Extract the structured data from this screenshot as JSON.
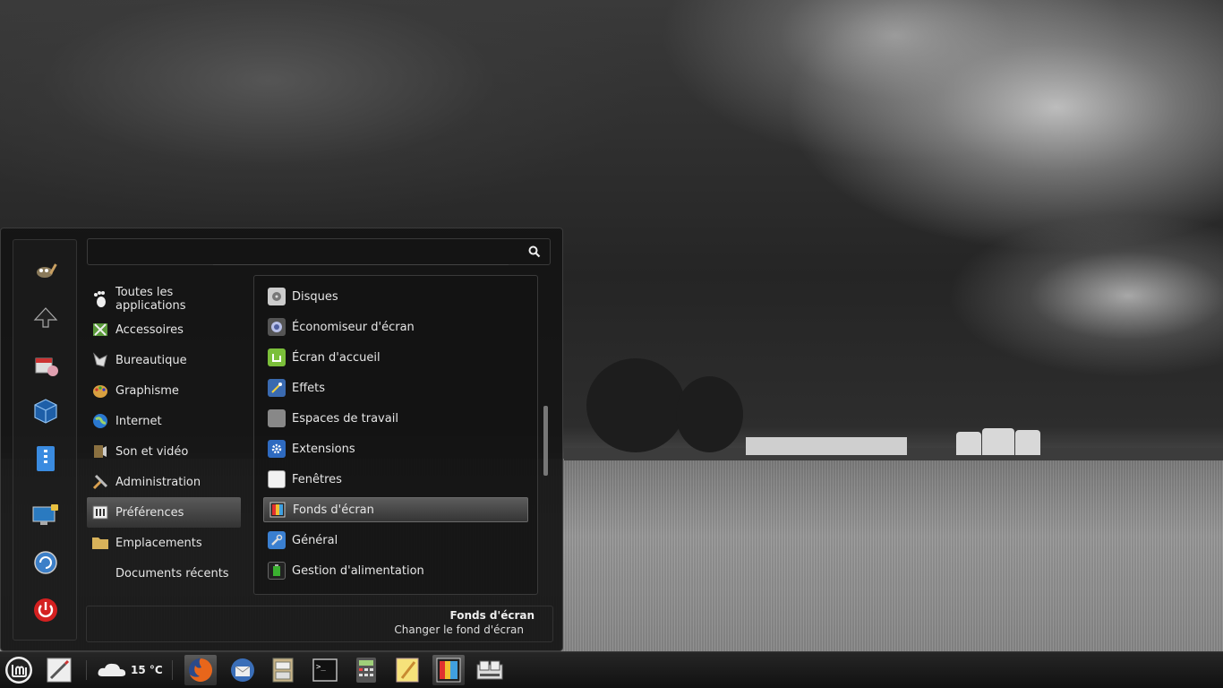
{
  "search": {
    "value": "",
    "placeholder": ""
  },
  "categories": [
    {
      "label": "Toutes les applications",
      "icon": "foot-icon"
    },
    {
      "label": "Accessoires",
      "icon": "accessories-icon"
    },
    {
      "label": "Bureautique",
      "icon": "office-icon"
    },
    {
      "label": "Graphisme",
      "icon": "graphics-icon"
    },
    {
      "label": "Internet",
      "icon": "internet-icon"
    },
    {
      "label": "Son et vidéo",
      "icon": "multimedia-icon"
    },
    {
      "label": "Administration",
      "icon": "administration-icon"
    },
    {
      "label": "Préférences",
      "icon": "preferences-icon",
      "selected": true
    },
    {
      "label": "Emplacements",
      "icon": "folder-icon"
    },
    {
      "label": "Documents récents",
      "icon": ""
    }
  ],
  "apps": [
    {
      "label": "Disques",
      "icon": "disks-icon"
    },
    {
      "label": "Économiseur d'écran",
      "icon": "screensaver-icon"
    },
    {
      "label": "Écran d'accueil",
      "icon": "login-screen-icon"
    },
    {
      "label": "Effets",
      "icon": "effects-icon"
    },
    {
      "label": "Espaces de travail",
      "icon": "workspaces-icon"
    },
    {
      "label": "Extensions",
      "icon": "extensions-icon"
    },
    {
      "label": "Fenêtres",
      "icon": "windows-icon"
    },
    {
      "label": "Fonds d'écran",
      "icon": "wallpaper-icon",
      "selected": true
    },
    {
      "label": "Général",
      "icon": "general-icon"
    },
    {
      "label": "Gestion d'alimentation",
      "icon": "power-management-icon"
    }
  ],
  "description": {
    "title": "Fonds d'écran",
    "subtitle": "Changer le fond d'écran"
  },
  "favorites": [
    "gimp-icon",
    "inkscape-icon",
    "package-manager-icon",
    "virtualbox-icon",
    "archive-icon",
    "computer-lock-icon",
    "update-manager-icon",
    "power-off-icon"
  ],
  "taskbar": {
    "weather": "15 °C",
    "launchers": [
      "mint-menu-icon",
      "text-editor-icon",
      "firefox-icon",
      "thunderbird-icon",
      "file-cabinet-icon",
      "terminal-icon",
      "calculator-icon",
      "notes-icon",
      "wallpaper-settings-icon",
      "drive-manager-icon"
    ]
  },
  "colors": {
    "power_red": "#d42020",
    "accent_blue": "#3a7fd0",
    "mint_green": "#7bbf3a"
  }
}
